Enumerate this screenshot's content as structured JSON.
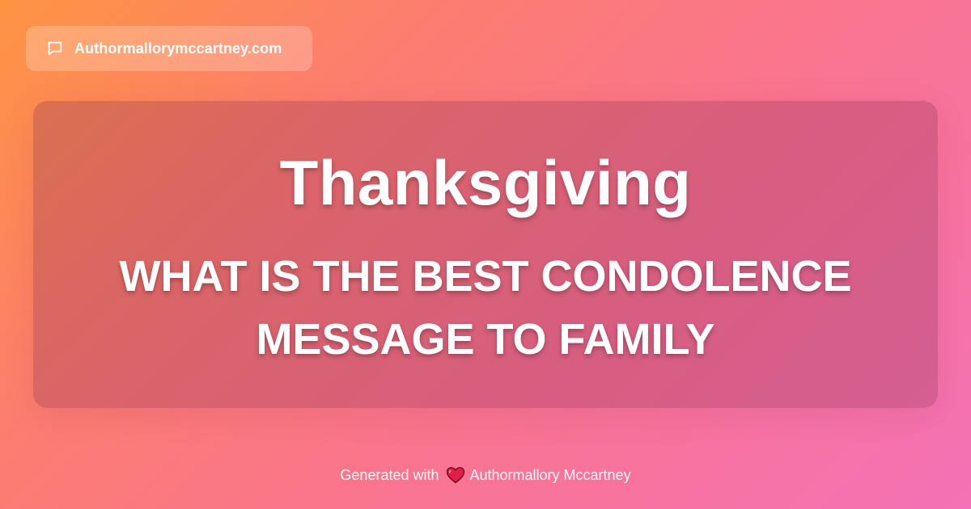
{
  "header": {
    "site_icon": "speech-bubble-icon",
    "site_name": "Authormallorymccartney.com"
  },
  "card": {
    "title": "Thanksgiving",
    "subtitle": "WHAT IS THE BEST CONDOLENCE MESSAGE TO FAMILY"
  },
  "footer": {
    "prefix": "Generated with",
    "heart_icon": "heart-icon",
    "heart_color": "#e11d48",
    "author": "Authormallory Mccartney"
  },
  "colors": {
    "gradient_start": "#fe9442",
    "gradient_end": "#f472b6",
    "text": "#ffffff"
  }
}
